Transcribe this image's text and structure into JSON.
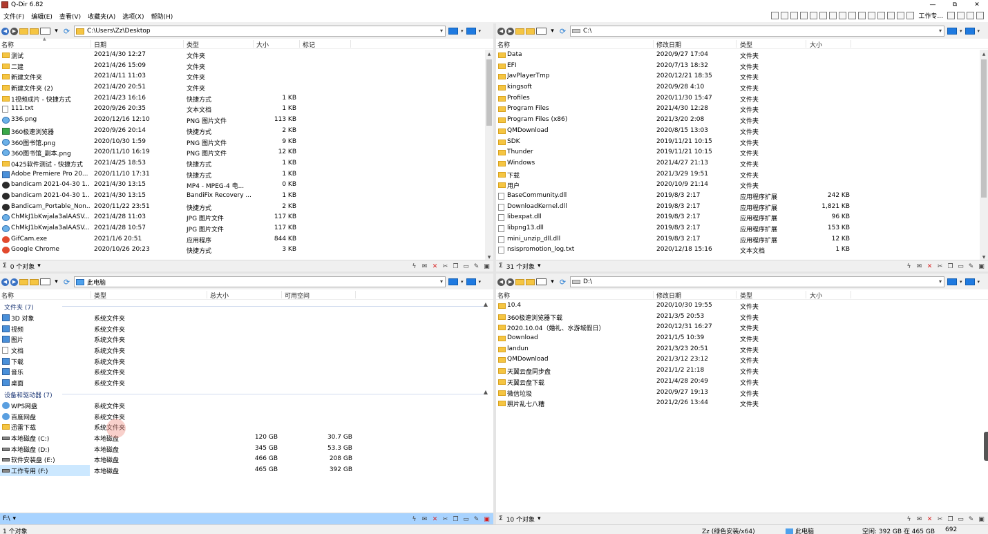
{
  "app": {
    "title": "Q-Dir 6.82",
    "win_buttons": [
      "—",
      "⧉",
      "✕"
    ]
  },
  "menu": [
    "文件(F)",
    "编辑(E)",
    "查看(V)",
    "收藏夹(A)",
    "选项(X)",
    "帮助(H)"
  ],
  "menu_tools": {
    "workspace_label": "工作专..."
  },
  "panes": {
    "tl": {
      "address": "C:\\Users\\Zz\\Desktop",
      "columns": [
        "名称",
        "日期",
        "类型",
        "大小",
        "标记"
      ],
      "rows": [
        {
          "icon": "folder",
          "name": "测试",
          "date": "2021/4/30 12:27",
          "type": "文件夹",
          "size": ""
        },
        {
          "icon": "folder",
          "name": "二建",
          "date": "2021/4/26 15:09",
          "type": "文件夹",
          "size": ""
        },
        {
          "icon": "folder",
          "name": "新建文件夹",
          "date": "2021/4/11 11:03",
          "type": "文件夹",
          "size": ""
        },
        {
          "icon": "folder",
          "name": "新建文件夹 (2)",
          "date": "2021/4/20 20:51",
          "type": "文件夹",
          "size": ""
        },
        {
          "icon": "shortcut",
          "name": "1视频成片 - 快捷方式",
          "date": "2021/4/23 16:16",
          "type": "快捷方式",
          "size": "1 KB"
        },
        {
          "icon": "file",
          "name": "111.txt",
          "date": "2020/9/26 20:35",
          "type": "文本文档",
          "size": "1 KB"
        },
        {
          "icon": "img",
          "name": "336.png",
          "date": "2020/12/16 12:10",
          "type": "PNG 图片文件",
          "size": "113 KB"
        },
        {
          "icon": "green",
          "name": "360极速浏览器",
          "date": "2020/9/26 20:14",
          "type": "快捷方式",
          "size": "2 KB"
        },
        {
          "icon": "img",
          "name": "360图书馆.png",
          "date": "2020/10/30 1:59",
          "type": "PNG 图片文件",
          "size": "9 KB"
        },
        {
          "icon": "img",
          "name": "360图书馆_副本.png",
          "date": "2020/11/10 16:19",
          "type": "PNG 图片文件",
          "size": "12 KB"
        },
        {
          "icon": "shortcut",
          "name": "0425软件测试 - 快捷方式",
          "date": "2021/4/25 18:53",
          "type": "快捷方式",
          "size": "1 KB"
        },
        {
          "icon": "sys",
          "name": "Adobe Premiere Pro 20...",
          "date": "2020/11/10 17:31",
          "type": "快捷方式",
          "size": "1 KB"
        },
        {
          "icon": "app",
          "name": "bandicam 2021-04-30 1...",
          "date": "2021/4/30 13:15",
          "type": "MP4 - MPEG-4 电...",
          "size": "0 KB"
        },
        {
          "icon": "app",
          "name": "bandicam 2021-04-30 1...",
          "date": "2021/4/30 13:15",
          "type": "BandiFix Recovery ...",
          "size": "1 KB"
        },
        {
          "icon": "app",
          "name": "Bandicam_Portable_Non...",
          "date": "2020/11/22 23:51",
          "type": "快捷方式",
          "size": "2 KB"
        },
        {
          "icon": "img",
          "name": "ChMkJ1bKwjala3alAASV...",
          "date": "2021/4/28 11:03",
          "type": "JPG 图片文件",
          "size": "117 KB"
        },
        {
          "icon": "img",
          "name": "ChMkJ1bKwjala3alAASV...",
          "date": "2021/4/28 10:57",
          "type": "JPG 图片文件",
          "size": "117 KB"
        },
        {
          "icon": "red",
          "name": "GifCam.exe",
          "date": "2021/1/6 20:51",
          "type": "应用程序",
          "size": "844 KB"
        },
        {
          "icon": "red",
          "name": "Google Chrome",
          "date": "2020/10/26 20:23",
          "type": "快捷方式",
          "size": "3 KB"
        }
      ],
      "status": "0 个对象"
    },
    "tr": {
      "address": "C:\\",
      "columns": [
        "名称",
        "修改日期",
        "类型",
        "大小"
      ],
      "rows": [
        {
          "icon": "folder",
          "name": "Data",
          "date": "2020/9/27 17:04",
          "type": "文件夹",
          "size": ""
        },
        {
          "icon": "folder",
          "name": "EFI",
          "date": "2020/7/13 18:32",
          "type": "文件夹",
          "size": ""
        },
        {
          "icon": "folder",
          "name": "JavPlayerTmp",
          "date": "2020/12/21 18:35",
          "type": "文件夹",
          "size": ""
        },
        {
          "icon": "folder",
          "name": "kingsoft",
          "date": "2020/9/28 4:10",
          "type": "文件夹",
          "size": ""
        },
        {
          "icon": "folder",
          "name": "Profiles",
          "date": "2020/11/30 15:47",
          "type": "文件夹",
          "size": ""
        },
        {
          "icon": "folder",
          "name": "Program Files",
          "date": "2021/4/30 12:28",
          "type": "文件夹",
          "size": ""
        },
        {
          "icon": "folder",
          "name": "Program Files (x86)",
          "date": "2021/3/20 2:08",
          "type": "文件夹",
          "size": ""
        },
        {
          "icon": "folder",
          "name": "QMDownload",
          "date": "2020/8/15 13:03",
          "type": "文件夹",
          "size": ""
        },
        {
          "icon": "folder",
          "name": "SDK",
          "date": "2019/11/21 10:15",
          "type": "文件夹",
          "size": ""
        },
        {
          "icon": "folder",
          "name": "Thunder",
          "date": "2019/11/21 10:15",
          "type": "文件夹",
          "size": ""
        },
        {
          "icon": "folder",
          "name": "Windows",
          "date": "2021/4/27 21:13",
          "type": "文件夹",
          "size": ""
        },
        {
          "icon": "folder",
          "name": "下载",
          "date": "2021/3/29 19:51",
          "type": "文件夹",
          "size": ""
        },
        {
          "icon": "folder",
          "name": "用户",
          "date": "2020/10/9 21:14",
          "type": "文件夹",
          "size": ""
        },
        {
          "icon": "file",
          "name": "BaseCommunity.dll",
          "date": "2019/8/3 2:17",
          "type": "应用程序扩展",
          "size": "242 KB"
        },
        {
          "icon": "file",
          "name": "DownloadKernel.dll",
          "date": "2019/8/3 2:17",
          "type": "应用程序扩展",
          "size": "1,821 KB"
        },
        {
          "icon": "file",
          "name": "libexpat.dll",
          "date": "2019/8/3 2:17",
          "type": "应用程序扩展",
          "size": "96 KB"
        },
        {
          "icon": "file",
          "name": "libpng13.dll",
          "date": "2019/8/3 2:17",
          "type": "应用程序扩展",
          "size": "153 KB"
        },
        {
          "icon": "file",
          "name": "mini_unzip_dll.dll",
          "date": "2019/8/3 2:17",
          "type": "应用程序扩展",
          "size": "12 KB"
        },
        {
          "icon": "file",
          "name": "nsispromotion_log.txt",
          "date": "2020/12/18 15:16",
          "type": "文本文档",
          "size": "1 KB"
        }
      ],
      "status": "31 个对象"
    },
    "bl": {
      "address": "此电脑",
      "columns": [
        "名称",
        "类型",
        "总大小",
        "可用空间"
      ],
      "group1": {
        "label": "文件夹 (7)"
      },
      "folders": [
        {
          "icon": "sys",
          "name": "3D 对象",
          "type": "系统文件夹"
        },
        {
          "icon": "sys",
          "name": "视频",
          "type": "系统文件夹"
        },
        {
          "icon": "sys",
          "name": "图片",
          "type": "系统文件夹"
        },
        {
          "icon": "file",
          "name": "文档",
          "type": "系统文件夹"
        },
        {
          "icon": "sys",
          "name": "下载",
          "type": "系统文件夹"
        },
        {
          "icon": "sys",
          "name": "音乐",
          "type": "系统文件夹"
        },
        {
          "icon": "sys",
          "name": "桌面",
          "type": "系统文件夹"
        }
      ],
      "group2": {
        "label": "设备和驱动器 (7)"
      },
      "drives": [
        {
          "icon": "cloud",
          "name": "WPS网盘",
          "type": "系统文件夹",
          "total": "",
          "free": ""
        },
        {
          "icon": "cloud",
          "name": "百度网盘",
          "type": "系统文件夹",
          "total": "",
          "free": ""
        },
        {
          "icon": "folder",
          "name": "迅雷下载",
          "type": "系统文件夹",
          "total": "",
          "free": ""
        },
        {
          "icon": "drive",
          "name": "本地磁盘 (C:)",
          "type": "本地磁盘",
          "total": "120 GB",
          "free": "30.7 GB"
        },
        {
          "icon": "drive",
          "name": "本地磁盘 (D:)",
          "type": "本地磁盘",
          "total": "345 GB",
          "free": "53.3 GB"
        },
        {
          "icon": "drive",
          "name": "软件安装盘 (E:)",
          "type": "本地磁盘",
          "total": "466 GB",
          "free": "208 GB"
        },
        {
          "icon": "drive",
          "name": "工作专用 (F:)",
          "type": "本地磁盘",
          "total": "465 GB",
          "free": "392 GB"
        }
      ],
      "status": "F:\\"
    },
    "br": {
      "address": "D:\\",
      "columns": [
        "名称",
        "修改日期",
        "类型",
        "大小"
      ],
      "rows": [
        {
          "icon": "folder",
          "name": "10.4",
          "date": "2020/10/30 19:55",
          "type": "文件夹",
          "size": ""
        },
        {
          "icon": "folder",
          "name": "360极速浏览器下载",
          "date": "2021/3/5 20:53",
          "type": "文件夹",
          "size": ""
        },
        {
          "icon": "folder",
          "name": "2020.10.04（婚礼、水游城假日）",
          "date": "2020/12/31 16:27",
          "type": "文件夹",
          "size": ""
        },
        {
          "icon": "folder",
          "name": "Download",
          "date": "2021/1/5 10:39",
          "type": "文件夹",
          "size": ""
        },
        {
          "icon": "folder",
          "name": "landun",
          "date": "2021/3/23 20:51",
          "type": "文件夹",
          "size": ""
        },
        {
          "icon": "folder",
          "name": "QMDownload",
          "date": "2021/3/12 23:12",
          "type": "文件夹",
          "size": ""
        },
        {
          "icon": "folder",
          "name": "天翼云盘同步盘",
          "date": "2021/1/2 21:18",
          "type": "文件夹",
          "size": ""
        },
        {
          "icon": "folder",
          "name": "天翼云盘下载",
          "date": "2021/4/28 20:49",
          "type": "文件夹",
          "size": ""
        },
        {
          "icon": "folder",
          "name": "微信垃圾",
          "date": "2020/9/27 19:13",
          "type": "文件夹",
          "size": ""
        },
        {
          "icon": "folder",
          "name": "照片乱七八糟",
          "date": "2021/2/26 13:44",
          "type": "文件夹",
          "size": ""
        }
      ],
      "status": "10 个对象"
    }
  },
  "statusbar": {
    "left": "1 个对象",
    "middle": "Zz (绿色安装/x64)",
    "pc": "此电脑",
    "free": "空闲: 392 GB 在 465 GB",
    "count": "692"
  }
}
